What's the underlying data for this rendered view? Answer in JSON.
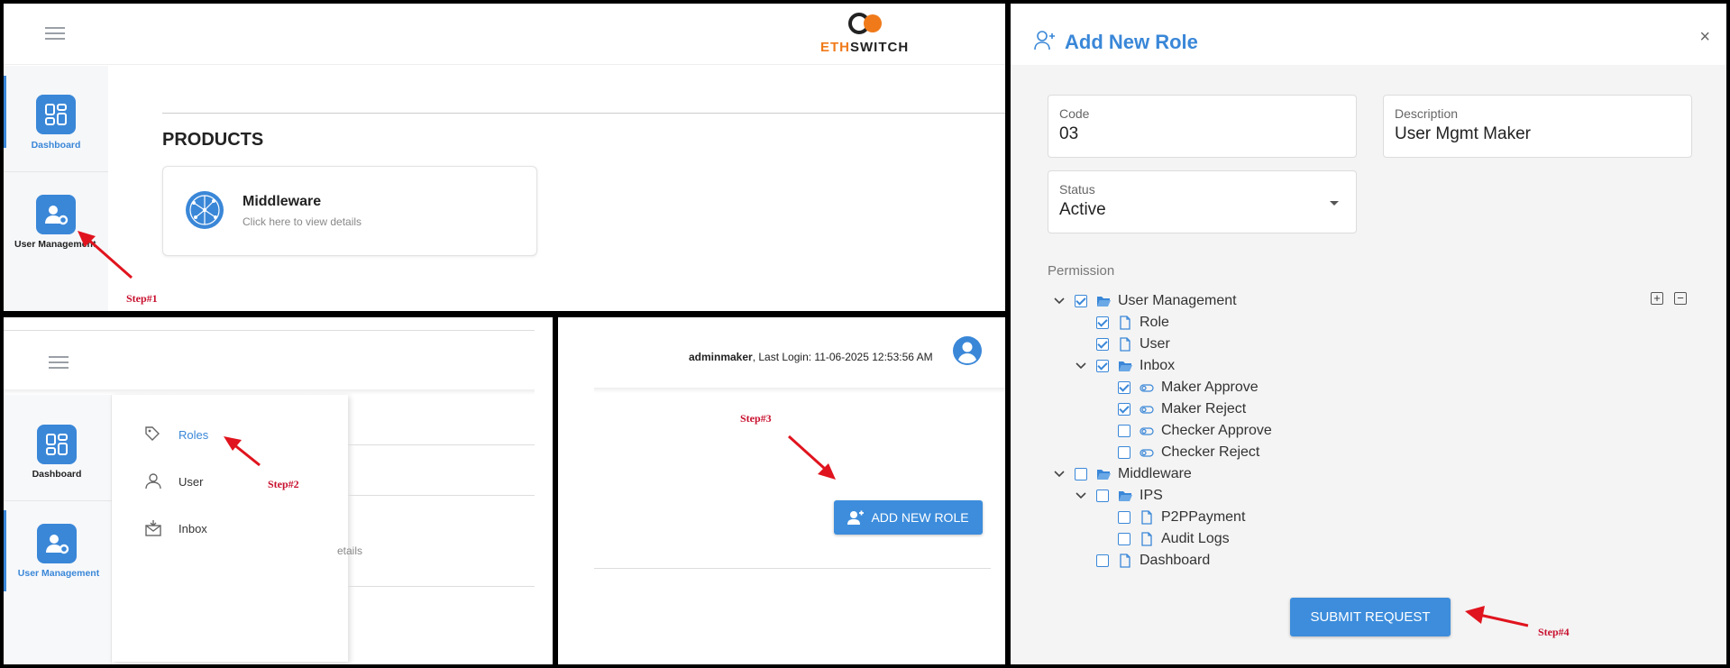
{
  "panel1": {
    "logo": {
      "text_eth": "ETH",
      "text_switch": "SWITCH"
    },
    "sidebar": [
      {
        "label": "Dashboard"
      },
      {
        "label": "User Management"
      }
    ],
    "products_title": "PRODUCTS",
    "product_card": {
      "title": "Middleware",
      "subtitle": "Click here to view details"
    },
    "step": "Step#1"
  },
  "panel2": {
    "sidebar": [
      {
        "label": "Dashboard"
      },
      {
        "label": "User Management"
      }
    ],
    "menu": [
      {
        "label": "Roles",
        "icon": "tag-icon"
      },
      {
        "label": "User",
        "icon": "user-icon"
      },
      {
        "label": "Inbox",
        "icon": "inbox-icon"
      }
    ],
    "behind_text": "etails",
    "step": "Step#2"
  },
  "panel3": {
    "user": "adminmaker",
    "login_label": ", Last Login: 11-06-2025 12:53:56 AM",
    "add_button": "ADD NEW ROLE",
    "step": "Step#3"
  },
  "dialog": {
    "title": "Add New Role",
    "close": "×",
    "code": {
      "label": "Code",
      "value": "03"
    },
    "description": {
      "label": "Description",
      "value": "User Mgmt Maker"
    },
    "status": {
      "label": "Status",
      "value": "Active"
    },
    "permission_label": "Permission",
    "tree": [
      {
        "label": "User Management",
        "checked": true
      },
      {
        "label": "Role",
        "checked": true
      },
      {
        "label": "User",
        "checked": true
      },
      {
        "label": "Inbox",
        "checked": true
      },
      {
        "label": "Maker Approve",
        "checked": true
      },
      {
        "label": "Maker Reject",
        "checked": true
      },
      {
        "label": "Checker Approve",
        "checked": false
      },
      {
        "label": "Checker Reject",
        "checked": false
      },
      {
        "label": "Middleware",
        "checked": false
      },
      {
        "label": "IPS",
        "checked": false
      },
      {
        "label": "P2PPayment",
        "checked": false
      },
      {
        "label": "Audit Logs",
        "checked": false
      },
      {
        "label": "Dashboard",
        "checked": false
      }
    ],
    "expand_all": "+",
    "collapse_all": "−",
    "submit": "SUBMIT REQUEST",
    "step": "Step#4"
  },
  "colors": {
    "accent": "#3a87d8",
    "logo_orange": "#f07a1a",
    "step_red": "#c8102e"
  }
}
